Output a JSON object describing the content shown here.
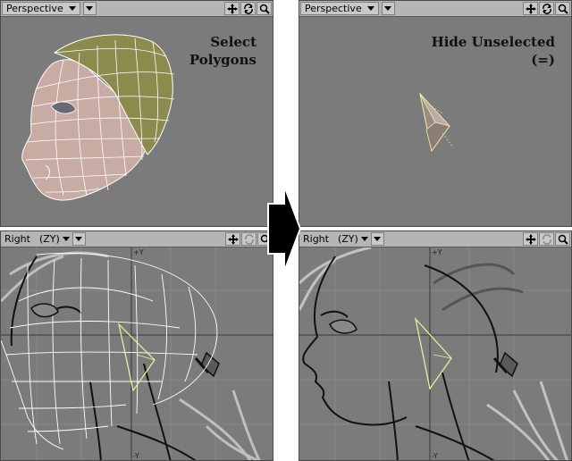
{
  "top_left": {
    "view_label": "Perspective",
    "overlay_line1": "Select",
    "overlay_line2": "Polygons"
  },
  "top_right": {
    "view_label": "Perspective",
    "overlay_line1": "Hide Unselected",
    "overlay_line2": "(=)"
  },
  "bottom_left": {
    "view_label": "Right",
    "axis_label": "(ZY)"
  },
  "bottom_right": {
    "view_label": "Right",
    "axis_label": "(ZY)"
  },
  "grid_labels": {
    "plus_y": "+Y",
    "minus_y": "-Y"
  },
  "icons": [
    "move-icon",
    "rotate-icon",
    "zoom-icon",
    "dropdown-arrow-icon",
    "transition-arrow-icon"
  ],
  "colors": {
    "viewport_bg": "#7b7b7b",
    "toolbar_bg": "#b5b5b5",
    "selected_polygon": "#8a8a4a",
    "unselected_polygon": "#c8a8a0",
    "wire": "#ffffff"
  }
}
